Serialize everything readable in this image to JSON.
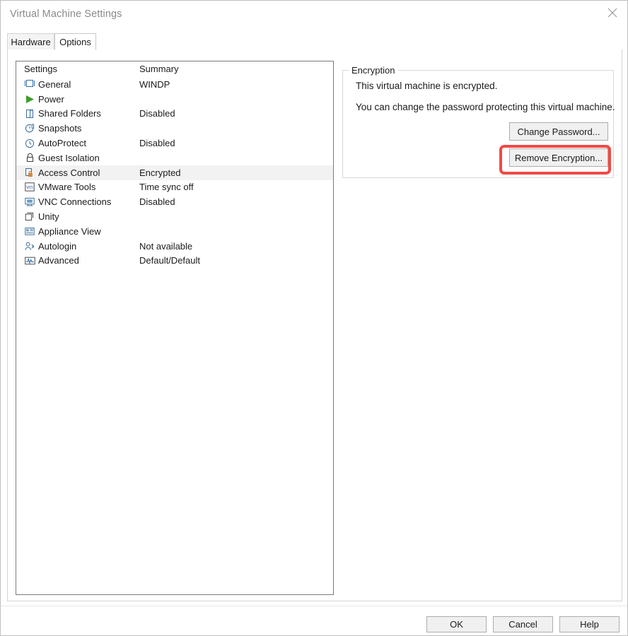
{
  "window": {
    "title": "Virtual Machine Settings",
    "close_icon": "close-icon"
  },
  "tabs": [
    {
      "label": "Hardware",
      "selected": false
    },
    {
      "label": "Options",
      "selected": true
    }
  ],
  "settings_list": {
    "columns": {
      "settings": "Settings",
      "summary": "Summary"
    },
    "rows": [
      {
        "icon": "general-icon",
        "label": "General",
        "summary": "WINDP"
      },
      {
        "icon": "power-icon",
        "label": "Power",
        "summary": ""
      },
      {
        "icon": "shared-folders-icon",
        "label": "Shared Folders",
        "summary": "Disabled"
      },
      {
        "icon": "snapshots-icon",
        "label": "Snapshots",
        "summary": ""
      },
      {
        "icon": "autoprotect-icon",
        "label": "AutoProtect",
        "summary": "Disabled"
      },
      {
        "icon": "lock-icon",
        "label": "Guest Isolation",
        "summary": ""
      },
      {
        "icon": "access-control-icon",
        "label": "Access Control",
        "summary": "Encrypted",
        "selected": true
      },
      {
        "icon": "vmware-tools-icon",
        "label": "VMware Tools",
        "summary": "Time sync off"
      },
      {
        "icon": "vnc-icon",
        "label": "VNC Connections",
        "summary": "Disabled"
      },
      {
        "icon": "unity-icon",
        "label": "Unity",
        "summary": ""
      },
      {
        "icon": "appliance-view-icon",
        "label": "Appliance View",
        "summary": ""
      },
      {
        "icon": "autologin-icon",
        "label": "Autologin",
        "summary": "Not available"
      },
      {
        "icon": "advanced-icon",
        "label": "Advanced",
        "summary": "Default/Default"
      }
    ]
  },
  "encryption": {
    "group_title": "Encryption",
    "line1": "This virtual machine is encrypted.",
    "line2": "You can change the password protecting this virtual machine.",
    "change_password_label": "Change Password...",
    "remove_encryption_label": "Remove Encryption..."
  },
  "footer": {
    "ok_label": "OK",
    "cancel_label": "Cancel",
    "help_label": "Help"
  },
  "colors": {
    "highlight": "#f04a45",
    "selection": "#f2f2f2",
    "title_text": "#8a8a8a",
    "power_green": "#3c9e28"
  }
}
